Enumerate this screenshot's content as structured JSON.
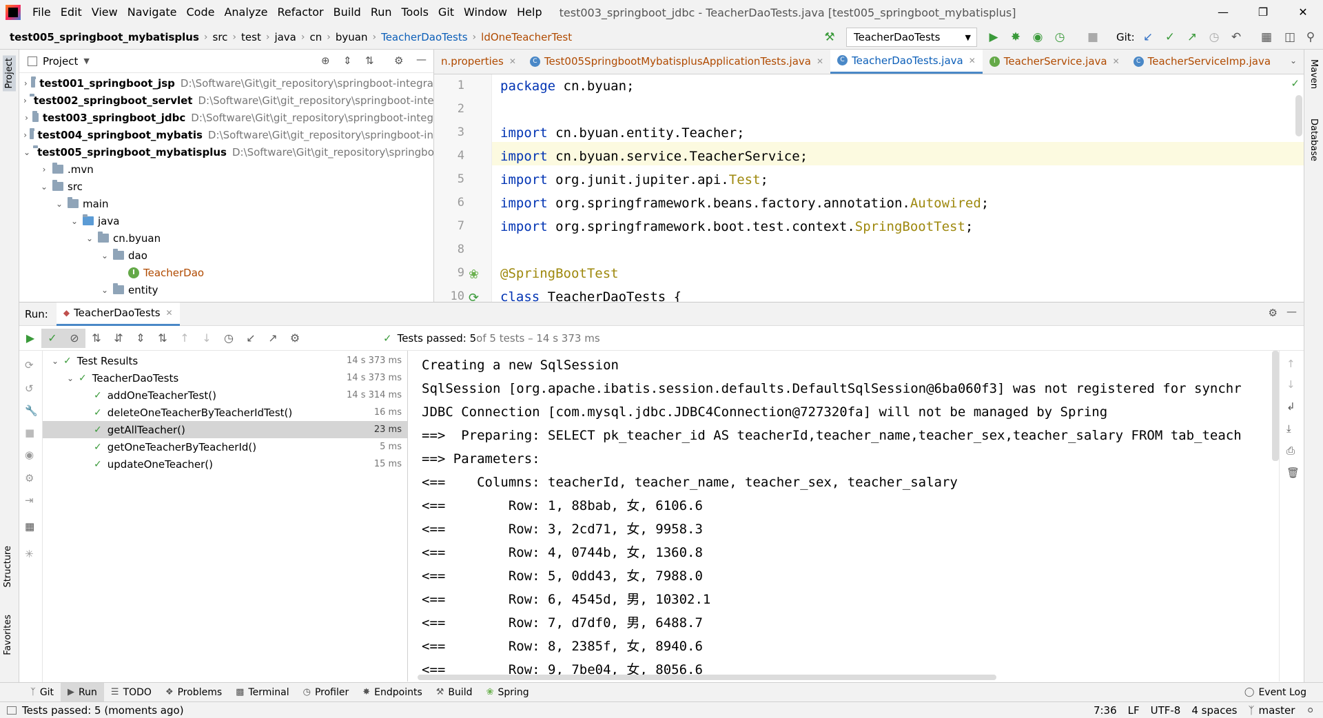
{
  "menubar": {
    "items": [
      "File",
      "Edit",
      "View",
      "Navigate",
      "Code",
      "Analyze",
      "Refactor",
      "Build",
      "Run",
      "Tools",
      "Git",
      "Window",
      "Help"
    ],
    "window_title": "test003_springboot_jdbc - TeacherDaoTests.java [test005_springboot_mybatisplus]"
  },
  "breadcrumb": [
    "test005_springboot_mybatisplus",
    "src",
    "test",
    "java",
    "cn",
    "byuan",
    "TeacherDaoTests",
    "ldOneTeacherTest"
  ],
  "toolbar": {
    "run_config": "TeacherDaoTests",
    "git_label": "Git:"
  },
  "project": {
    "title": "Project",
    "rows": [
      {
        "name": "test001_springboot_jsp",
        "path": "D:\\Software\\Git\\git_repository\\springboot-integra"
      },
      {
        "name": "test002_springboot_servlet",
        "path": "D:\\Software\\Git\\git_repository\\springboot-inte"
      },
      {
        "name": "test003_springboot_jdbc",
        "path": "D:\\Software\\Git\\git_repository\\springboot-integ"
      },
      {
        "name": "test004_springboot_mybatis",
        "path": "D:\\Software\\Git\\git_repository\\springboot-in"
      },
      {
        "name": "test005_springboot_mybatisplus",
        "path": "D:\\Software\\Git\\git_repository\\springboo"
      }
    ],
    "sub": [
      ".mvn",
      "src",
      "main",
      "java",
      "cn.byuan",
      "dao",
      "TeacherDao",
      "entity"
    ]
  },
  "editor_tabs": [
    "n.properties",
    "Test005SpringbootMybatisplusApplicationTests.java",
    "TeacherDaoTests.java",
    "TeacherService.java",
    "TeacherServiceImp.java"
  ],
  "code": {
    "line_numbers": [
      "1",
      "2",
      "3",
      "4",
      "5",
      "6",
      "7",
      "8",
      "9",
      "10"
    ],
    "l1a": "package",
    "l1b": " cn.byuan;",
    "l3a": "import",
    "l3b": " cn.byuan.entity.Teacher;",
    "l4a": "import",
    "l4b": " cn.byuan.service.TeacherService;",
    "l5a": "import",
    "l5b": " org.junit.jupiter.api.",
    "l5c": "Test",
    "l5d": ";",
    "l6a": "import",
    "l6b": " org.springframework.beans.factory.annotation.",
    "l6c": "Autowired",
    "l6d": ";",
    "l7a": "import",
    "l7b": " org.springframework.boot.test.context.",
    "l7c": "SpringBootTest",
    "l7d": ";",
    "l9": "@SpringBootTest",
    "l10a": "class",
    "l10b": " TeacherDaoTests {"
  },
  "run": {
    "label": "Run:",
    "tab": "TeacherDaoTests",
    "status_bold": "Tests passed: 5",
    "status_rest": " of 5 tests – 14 s 373 ms",
    "results": [
      {
        "name": "Test Results",
        "time": "14 s 373 ms"
      },
      {
        "name": "TeacherDaoTests",
        "time": "14 s 373 ms"
      },
      {
        "name": "addOneTeacherTest()",
        "time": "14 s 314 ms"
      },
      {
        "name": "deleteOneTeacherByTeacherIdTest()",
        "time": "16 ms"
      },
      {
        "name": "getAllTeacher()",
        "time": "23 ms"
      },
      {
        "name": "getOneTeacherByTeacherId()",
        "time": "5 ms"
      },
      {
        "name": "updateOneTeacher()",
        "time": "15 ms"
      }
    ],
    "console": [
      "Creating a new SqlSession",
      "SqlSession [org.apache.ibatis.session.defaults.DefaultSqlSession@6ba060f3] was not registered for synchr",
      "JDBC Connection [com.mysql.jdbc.JDBC4Connection@727320fa] will not be managed by Spring",
      "==>  Preparing: SELECT pk_teacher_id AS teacherId,teacher_name,teacher_sex,teacher_salary FROM tab_teach",
      "==> Parameters: ",
      "<==    Columns: teacherId, teacher_name, teacher_sex, teacher_salary",
      "<==        Row: 1, 88bab, 女, 6106.6",
      "<==        Row: 3, 2cd71, 女, 9958.3",
      "<==        Row: 4, 0744b, 女, 1360.8",
      "<==        Row: 5, 0dd43, 女, 7988.0",
      "<==        Row: 6, 4545d, 男, 10302.1",
      "<==        Row: 7, d7df0, 男, 6488.7",
      "<==        Row: 8, 2385f, 女, 8940.6",
      "<==        Row: 9, 7be04, 女, 8056.6"
    ]
  },
  "bottom_tabs": [
    "Git",
    "Run",
    "TODO",
    "Problems",
    "Terminal",
    "Profiler",
    "Endpoints",
    "Build",
    "Spring"
  ],
  "event_log": "Event Log",
  "left_vtabs": {
    "project": "Project",
    "structure": "Structure",
    "favorites": "Favorites"
  },
  "right_vtabs": {
    "maven": "Maven",
    "database": "Database"
  },
  "status": {
    "message": "Tests passed: 5 (moments ago)",
    "position": "7:36",
    "line_sep": "LF",
    "encoding": "UTF-8",
    "indent": "4 spaces",
    "branch": "master"
  }
}
